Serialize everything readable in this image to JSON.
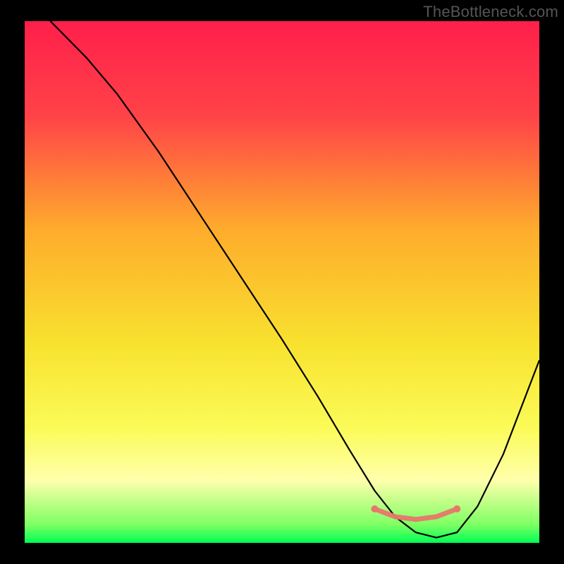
{
  "watermark": "TheBottleneck.com",
  "chart_data": {
    "type": "line",
    "title": "",
    "xlabel": "",
    "ylabel": "",
    "xlim": [
      0,
      100
    ],
    "ylim": [
      0,
      100
    ],
    "grid": false,
    "legend": false,
    "gradient_stops": [
      {
        "offset": 0,
        "color": "#ff1f4b"
      },
      {
        "offset": 0.18,
        "color": "#ff4248"
      },
      {
        "offset": 0.4,
        "color": "#feac2c"
      },
      {
        "offset": 0.62,
        "color": "#f8e22f"
      },
      {
        "offset": 0.78,
        "color": "#fbfb58"
      },
      {
        "offset": 0.88,
        "color": "#ffffac"
      },
      {
        "offset": 0.965,
        "color": "#7eff63"
      },
      {
        "offset": 1.0,
        "color": "#00ff55"
      }
    ],
    "series": [
      {
        "name": "bottleneck-curve",
        "x": [
          5,
          8,
          12,
          18,
          26,
          34,
          42,
          50,
          57,
          63,
          68,
          72,
          76,
          80,
          84,
          88,
          93,
          100
        ],
        "values": [
          100,
          97,
          93,
          86,
          75,
          63,
          51,
          39,
          28,
          18,
          10,
          5,
          2,
          1,
          2,
          7,
          17,
          35
        ]
      }
    ],
    "markers": {
      "name": "optimal-range",
      "x": [
        68,
        72,
        76,
        80,
        84
      ],
      "values": [
        6.5,
        5,
        4.5,
        5,
        6.5
      ]
    }
  }
}
